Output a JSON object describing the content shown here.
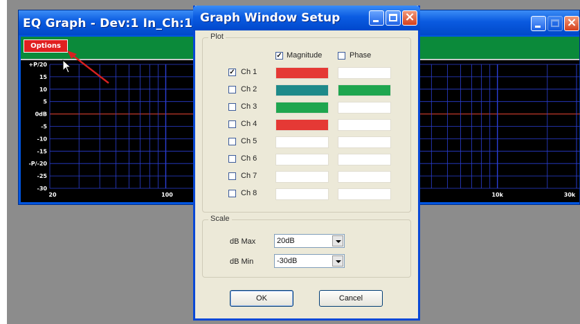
{
  "eq_window": {
    "title": "EQ Graph - Dev:1 In_Ch:1",
    "options_label": "Options",
    "y_labels": [
      "+P/20",
      "15",
      "10",
      "5",
      "0dB",
      "-5",
      "-10",
      "-15",
      "-P/-20",
      "-25",
      "-30"
    ],
    "x_labels": [
      "20",
      "100",
      "10k",
      "30k"
    ],
    "grid_color": "#2b3fd6",
    "zero_line_color": "#c0392b"
  },
  "dialog": {
    "title": "Graph Window Setup",
    "plot_group_label": "Plot",
    "magnitude_label": "Magnitude",
    "magnitude_checked": true,
    "phase_label": "Phase",
    "phase_checked": false,
    "channels": [
      {
        "label": "Ch 1",
        "checked": true,
        "magnitude_color": "#e53935",
        "phase_color": "#ffffff"
      },
      {
        "label": "Ch 2",
        "checked": false,
        "magnitude_color": "#1e8a8a",
        "phase_color": "#1fa64f"
      },
      {
        "label": "Ch 3",
        "checked": false,
        "magnitude_color": "#1fa64f",
        "phase_color": "#ffffff"
      },
      {
        "label": "Ch 4",
        "checked": false,
        "magnitude_color": "#e53935",
        "phase_color": "#ffffff"
      },
      {
        "label": "Ch 5",
        "checked": false,
        "magnitude_color": "#ffffff",
        "phase_color": "#ffffff"
      },
      {
        "label": "Ch 6",
        "checked": false,
        "magnitude_color": "#ffffff",
        "phase_color": "#ffffff"
      },
      {
        "label": "Ch 7",
        "checked": false,
        "magnitude_color": "#ffffff",
        "phase_color": "#ffffff"
      },
      {
        "label": "Ch 8",
        "checked": false,
        "magnitude_color": "#ffffff",
        "phase_color": "#ffffff"
      }
    ],
    "scale_group_label": "Scale",
    "db_max_label": "dB Max",
    "db_max_value": "20dB",
    "db_min_label": "dB Min",
    "db_min_value": "-30dB",
    "ok_label": "OK",
    "cancel_label": "Cancel"
  }
}
